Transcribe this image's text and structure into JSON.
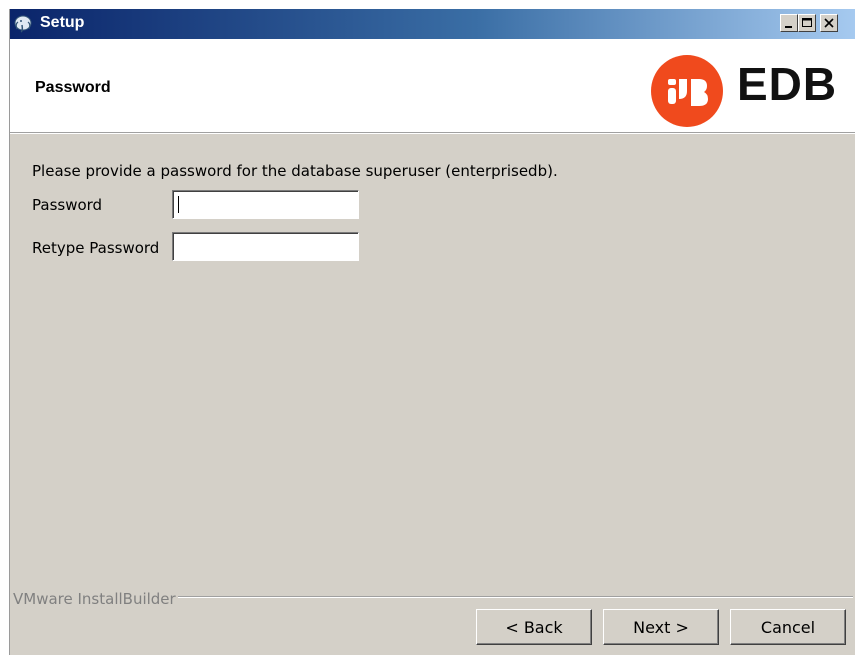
{
  "window": {
    "title": "Setup",
    "controls": {
      "minimize": "minimize-icon",
      "maximize": "maximize-icon",
      "close": "close-icon"
    }
  },
  "header": {
    "title": "Password",
    "logo_text": "EDB",
    "logo_color": "#f04a1d"
  },
  "form": {
    "instruction": "Please provide a password for the database superuser (enterprisedb).",
    "password_label": "Password",
    "password_value": "",
    "retype_label": "Retype Password",
    "retype_value": ""
  },
  "footer": {
    "brand": "VMware InstallBuilder",
    "back_label": "< Back",
    "next_label": "Next >",
    "cancel_label": "Cancel"
  }
}
